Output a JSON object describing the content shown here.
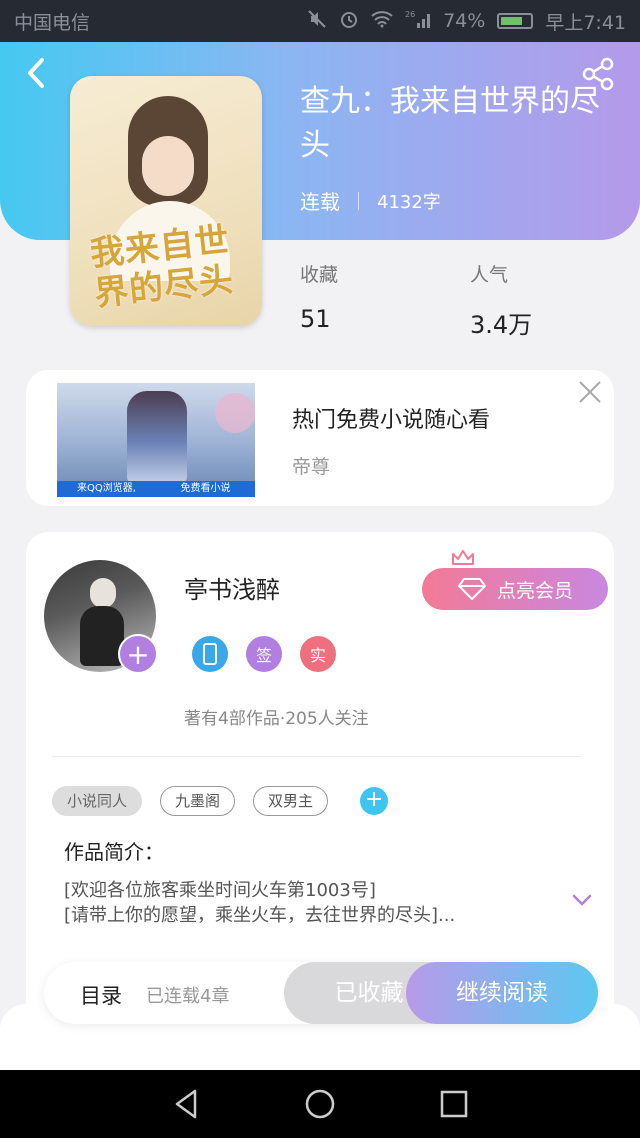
{
  "status_bar": {
    "carrier": "中国电信",
    "signal_label": "26",
    "battery": "74%",
    "time": "早上7:41",
    "battery_level": 0.74
  },
  "book": {
    "title": "查九：我来自世界的尽头",
    "status": "连载",
    "word_count": "4132字",
    "cover_title": "我来自世界的尽头",
    "favorites_label": "收藏",
    "favorites_value": "51",
    "popularity_label": "人气",
    "popularity_value": "3.4万"
  },
  "ad": {
    "title": "热门免费小说随心看",
    "subtitle": "帝尊",
    "strip_left": "来QQ浏览器,",
    "strip_right": "免费看小说"
  },
  "author": {
    "name": "亭书浅醉",
    "vip_label": "点亮会员",
    "badges": [
      "",
      "签",
      "实"
    ],
    "stats": "著有4部作品·205人关注"
  },
  "tags": [
    "小说同人",
    "九墨阁",
    "双男主"
  ],
  "intro": {
    "heading": "作品简介：",
    "line1": "[欢迎各位旅客乘坐时间火车第1003号]",
    "line2": "[请带上你的愿望，乘坐火车，去往世界的尽头]..."
  },
  "action_bar": {
    "toc_label": "目录",
    "toc_count": "已连载4章",
    "saved_label": "已收藏",
    "read_label": "继续阅读"
  },
  "icons": {
    "back": "chevron-left-icon",
    "share": "share-icon",
    "close": "close-icon",
    "expand": "chevron-down-icon",
    "diamond": "diamond-icon",
    "crown": "crown-icon"
  },
  "colors": {
    "header_start": "#45c9f1",
    "header_end": "#b49aea",
    "vip_start": "#f37a95",
    "vip_end": "#c987e0",
    "read_start": "#b79ae9",
    "read_end": "#5bc8f0"
  }
}
